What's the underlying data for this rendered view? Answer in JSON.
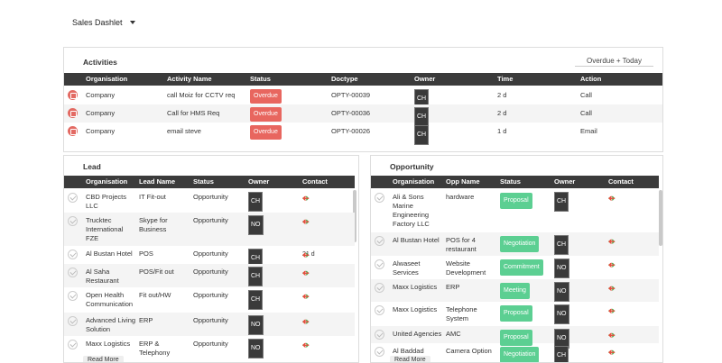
{
  "dashlet_select": {
    "label": "Sales Dashlet"
  },
  "activities": {
    "title": "Activities",
    "filter": "Overdue + Today",
    "columns": [
      "Organisation",
      "Activity Name",
      "Status",
      "Doctype",
      "Owner",
      "Time",
      "Action"
    ],
    "rows": [
      {
        "icon": "phone-icon",
        "org": "Company",
        "name": "call Moiz for CCTV req",
        "status": "Overdue",
        "doctype": "OPTY-00039",
        "owner": "CH",
        "time": "2 d",
        "action": "Call"
      },
      {
        "icon": "phone-icon",
        "org": "Company",
        "name": "Call for HMS Req",
        "status": "Overdue",
        "doctype": "OPTY-00036",
        "owner": "CH",
        "time": "2 d",
        "action": "Call"
      },
      {
        "icon": "email-icon",
        "org": "Company",
        "name": "email steve",
        "status": "Overdue",
        "doctype": "OPTY-00026",
        "owner": "CH",
        "time": "1 d",
        "action": "Email"
      }
    ]
  },
  "lead": {
    "title": "Lead",
    "columns": [
      "Organisation",
      "Lead Name",
      "Status",
      "Owner",
      "Contact"
    ],
    "rows": [
      {
        "org": "CBD Projects LLC",
        "name": "IT Fit-out",
        "status": "Opportunity",
        "owner": "CH",
        "contact_note": ""
      },
      {
        "org": "Trucktec International FZE",
        "name": "Skype for Business",
        "status": "Opportunity",
        "owner": "NO",
        "contact_note": ""
      },
      {
        "org": "Al Bustan Hotel",
        "name": "POS",
        "status": "Opportunity",
        "owner": "CH",
        "contact_note": "21 d"
      },
      {
        "org": "Al Saha Restaurant",
        "name": "POS/Fit out",
        "status": "Opportunity",
        "owner": "CH",
        "contact_note": ""
      },
      {
        "org": "Open Health Communication",
        "name": "Fit out/HW",
        "status": "Opportunity",
        "owner": "CH",
        "contact_note": ""
      },
      {
        "org": "Advanced Living Solution",
        "name": "ERP",
        "status": "Opportunity",
        "owner": "NO",
        "contact_note": ""
      },
      {
        "org": "Maxx Logistics",
        "name": "ERP & Telephony",
        "status": "Opportunity",
        "owner": "NO",
        "contact_note": ""
      }
    ],
    "read_more": "Read More"
  },
  "opportunity": {
    "title": "Opportunity",
    "columns": [
      "Organisation",
      "Opp Name",
      "Status",
      "Owner",
      "Contact"
    ],
    "rows": [
      {
        "org": "Ali & Sons Marine Engineering Factory LLC",
        "name": "hardware",
        "status": "Proposal",
        "owner": "CH"
      },
      {
        "org": "Al Bustan Hotel",
        "name": "POS for 4 restaurant",
        "status": "Negotiation",
        "owner": "CH"
      },
      {
        "org": "Alwaseet Services",
        "name": "Website Development",
        "status": "Commitment",
        "owner": "NO"
      },
      {
        "org": "Maxx Logistics",
        "name": "ERP",
        "status": "Meeting",
        "owner": "NO"
      },
      {
        "org": "Maxx Logistics",
        "name": "Telephone System",
        "status": "Proposal",
        "owner": "NO"
      },
      {
        "org": "United Agencies",
        "name": "AMC",
        "status": "Proposal",
        "owner": "NO"
      },
      {
        "org": "Al Baddad",
        "name": "Camera Option",
        "status": "Negotiation",
        "owner": "CH"
      }
    ],
    "read_more": "Read More"
  }
}
